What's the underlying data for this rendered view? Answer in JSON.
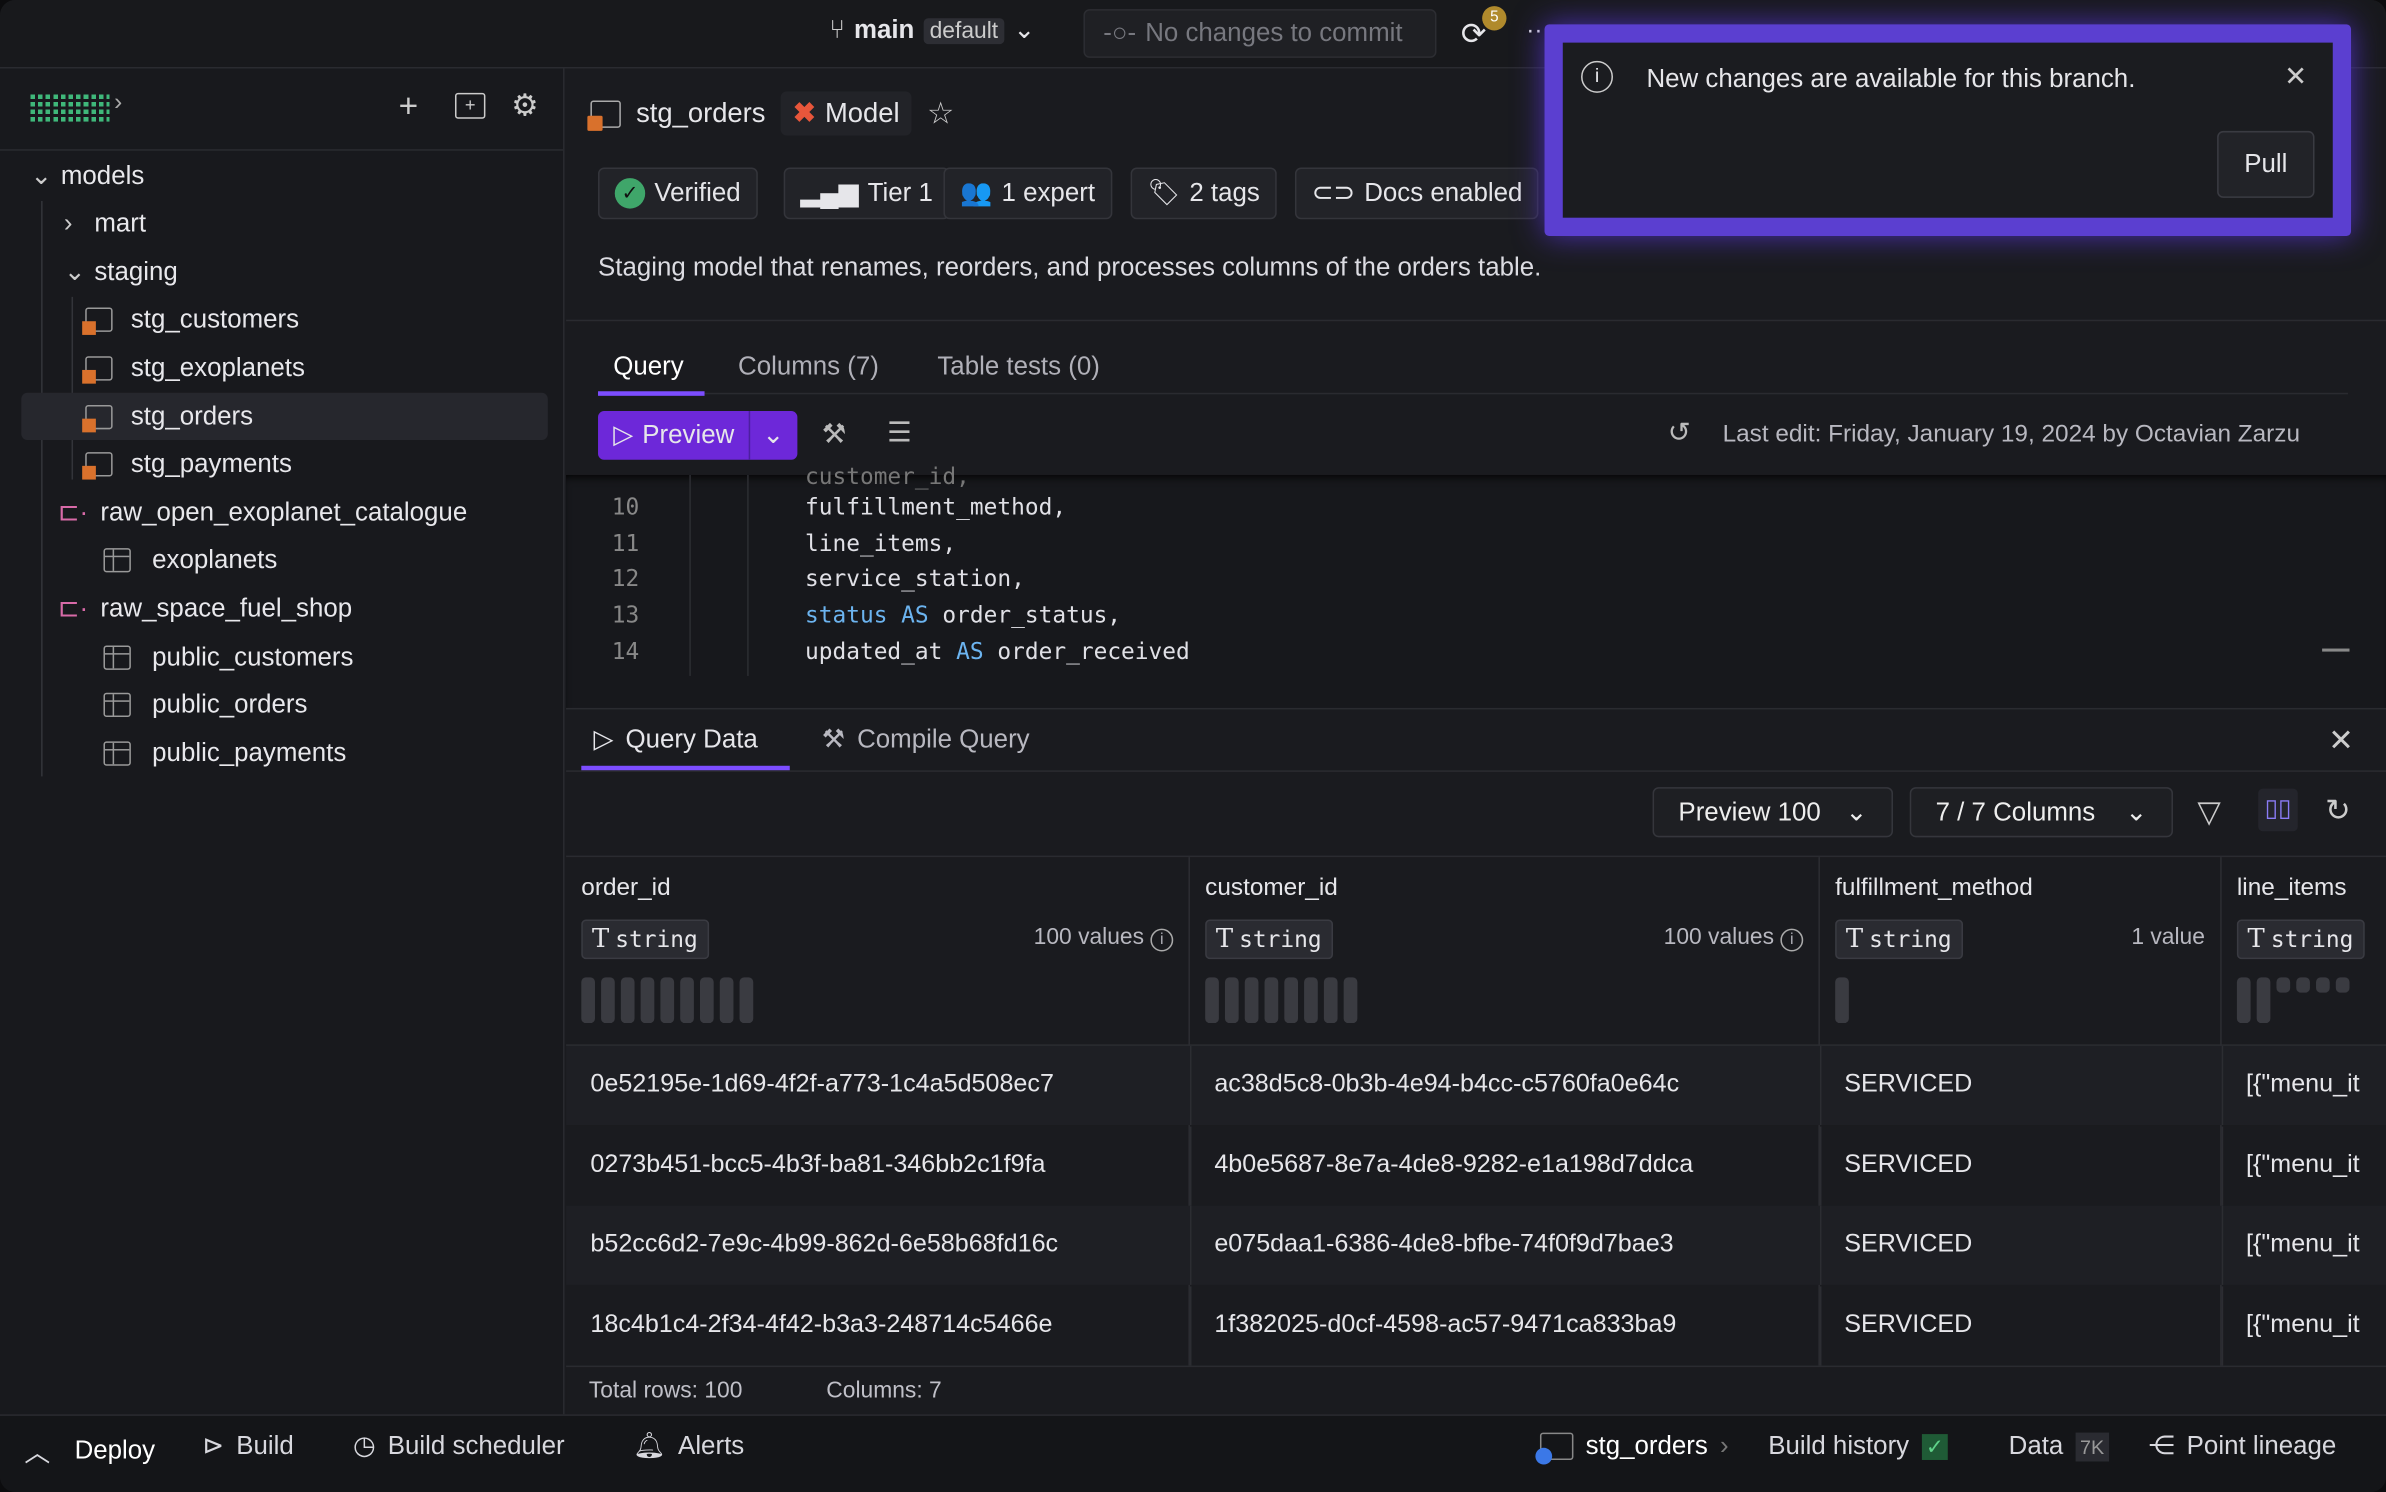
{
  "topbar": {
    "branch": "main",
    "branch_tag": "default",
    "commit_label": "No changes to commit",
    "sync_badge": "5",
    "more": "···"
  },
  "notification": {
    "message": "New changes are available for this branch.",
    "pull_label": "Pull",
    "border_color": "#5b3fd0"
  },
  "sidebar": {
    "tree": [
      {
        "label": "models",
        "type": "folder",
        "expanded": true
      },
      {
        "label": "mart",
        "type": "folder",
        "expanded": false
      },
      {
        "label": "staging",
        "type": "folder",
        "expanded": true
      },
      {
        "label": "stg_customers",
        "type": "model"
      },
      {
        "label": "stg_exoplanets",
        "type": "model"
      },
      {
        "label": "stg_orders",
        "type": "model",
        "selected": true
      },
      {
        "label": "stg_payments",
        "type": "model"
      },
      {
        "label": "raw_open_exoplanet_catalogue",
        "type": "source"
      },
      {
        "label": "exoplanets",
        "type": "table"
      },
      {
        "label": "raw_space_fuel_shop",
        "type": "source"
      },
      {
        "label": "public_customers",
        "type": "table"
      },
      {
        "label": "public_orders",
        "type": "table"
      },
      {
        "label": "public_payments",
        "type": "table"
      }
    ]
  },
  "header": {
    "title": "stg_orders",
    "kind": "Model",
    "badges": [
      "Verified",
      "Tier 1",
      "1 expert",
      "2 tags",
      "Docs enabled"
    ],
    "description": "Staging model that renames, reorders, and processes columns of the orders table."
  },
  "tabs": [
    "Query",
    "Columns (7)",
    "Table tests (0)"
  ],
  "toolbar": {
    "preview": "Preview",
    "last_edit": "Last edit: Friday, January 19, 2024 by Octavian Zarzu"
  },
  "code": {
    "lines": [
      {
        "n": "10",
        "text": "fulfillment_method,"
      },
      {
        "n": "11",
        "text": "line_items,"
      },
      {
        "n": "12",
        "text": "service_station,"
      },
      {
        "n": "13",
        "kw1": "status",
        "kw2": "AS",
        "rest": " order_status,"
      },
      {
        "n": "14",
        "pre": "updated_at ",
        "kw2": "AS",
        "rest": " order_received"
      }
    ],
    "partial": "customer_id,"
  },
  "results": {
    "tabs": [
      "Query Data",
      "Compile Query"
    ],
    "preview_select": "Preview 100",
    "columns_select": "7 / 7 Columns",
    "columns": [
      {
        "name": "order_id",
        "type": "string",
        "values": "100 values"
      },
      {
        "name": "customer_id",
        "type": "string",
        "values": "100 values"
      },
      {
        "name": "fulfillment_method",
        "type": "string",
        "values": "1 value"
      },
      {
        "name": "line_items",
        "type": "string",
        "values": ""
      }
    ],
    "rows": [
      [
        "0e52195e-1d69-4f2f-a773-1c4a5d508ec7",
        "ac38d5c8-0b3b-4e94-b4cc-c5760fa0e64c",
        "SERVICED",
        "[{\"menu_it"
      ],
      [
        "0273b451-bcc5-4b3f-ba81-346bb2c1f9fa",
        "4b0e5687-8e7a-4de8-9282-e1a198d7ddca",
        "SERVICED",
        "[{\"menu_it"
      ],
      [
        "b52cc6d2-7e9c-4b99-862d-6e58b68fd16c",
        "e075daa1-6386-4de8-bfbe-74f0f9d7bae3",
        "SERVICED",
        "[{\"menu_it"
      ],
      [
        "18c4b1c4-2f34-4f42-b3a3-248714c5466e",
        "1f382025-d0cf-4598-ac57-9471ca833ba9",
        "SERVICED",
        "[{\"menu_it"
      ]
    ],
    "total_rows": "Total rows: 100",
    "total_columns": "Columns: 7"
  },
  "statusbar": {
    "deploy": "Deploy",
    "build": "Build",
    "scheduler": "Build scheduler",
    "alerts": "Alerts",
    "model": "stg_orders",
    "history": "Build history",
    "data": "Data",
    "data_count": "7K",
    "lineage": "Point lineage"
  },
  "colors": {
    "accent": "#6d28d9",
    "verified": "#3fa66a",
    "model_icon": "#e8563b",
    "keyword": "#6cb4f0"
  }
}
